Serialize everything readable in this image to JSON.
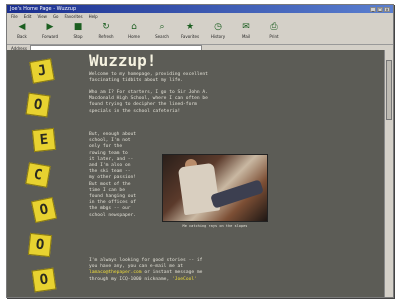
{
  "window": {
    "title": "Joe's Home Page - Wuzzup",
    "controls": [
      "_",
      "□",
      "×"
    ]
  },
  "menu": [
    "File",
    "Edit",
    "View",
    "Go",
    "Favorites",
    "Help"
  ],
  "toolbar": [
    {
      "label": "Back",
      "icon": "back-arrow-icon",
      "glyph": "◀"
    },
    {
      "label": "Forward",
      "icon": "forward-arrow-icon",
      "glyph": "▶"
    },
    {
      "label": "Stop",
      "icon": "stop-icon",
      "glyph": "■"
    },
    {
      "label": "Refresh",
      "icon": "refresh-icon",
      "glyph": "↻"
    },
    {
      "label": "Home",
      "icon": "home-icon",
      "glyph": "⌂"
    },
    {
      "label": "Search",
      "icon": "search-icon",
      "glyph": "⌕"
    },
    {
      "label": "Favorites",
      "icon": "favorites-icon",
      "glyph": "★"
    },
    {
      "label": "History",
      "icon": "history-icon",
      "glyph": "◷"
    },
    {
      "label": "Mail",
      "icon": "mail-icon",
      "glyph": "✉"
    },
    {
      "label": "Print",
      "icon": "print-icon",
      "glyph": "⎙"
    }
  ],
  "address": {
    "label": "Address"
  },
  "page": {
    "letters": [
      "J",
      "O",
      "E",
      "C",
      "O",
      "O",
      "O"
    ],
    "headline": "Wuzzup!",
    "intro": "Welcome to my homepage, providing excellent\nfascinating tidbits about my life.",
    "para2": "Who am I? For starters, I go to Sir John A.\nMacdonald High School, where I can often be\nfound trying to decipher the lined-form\nspecials in the school cafeteria!",
    "para3": "But, enough about\nschool, I'm not\nonly for the\nrowing team to\nit later, and --\nand I'm also on\nthe ski team --\nmy other passion!\nBut most of the\ntime I can be\nfound hanging out\nin the offices of\nthe mbgs -- our\nschool newspaper.",
    "caption": "Me catching rays on the slopes",
    "para4a": "I'm always looking for good stories -- if\nyou have any, you can e-mail me at\n",
    "email": "lamaco@thepaper.com",
    "para4b": " or instant message me\nthrough my ICQ-1000 nickname, ",
    "nickname": "'JoeCool'"
  }
}
